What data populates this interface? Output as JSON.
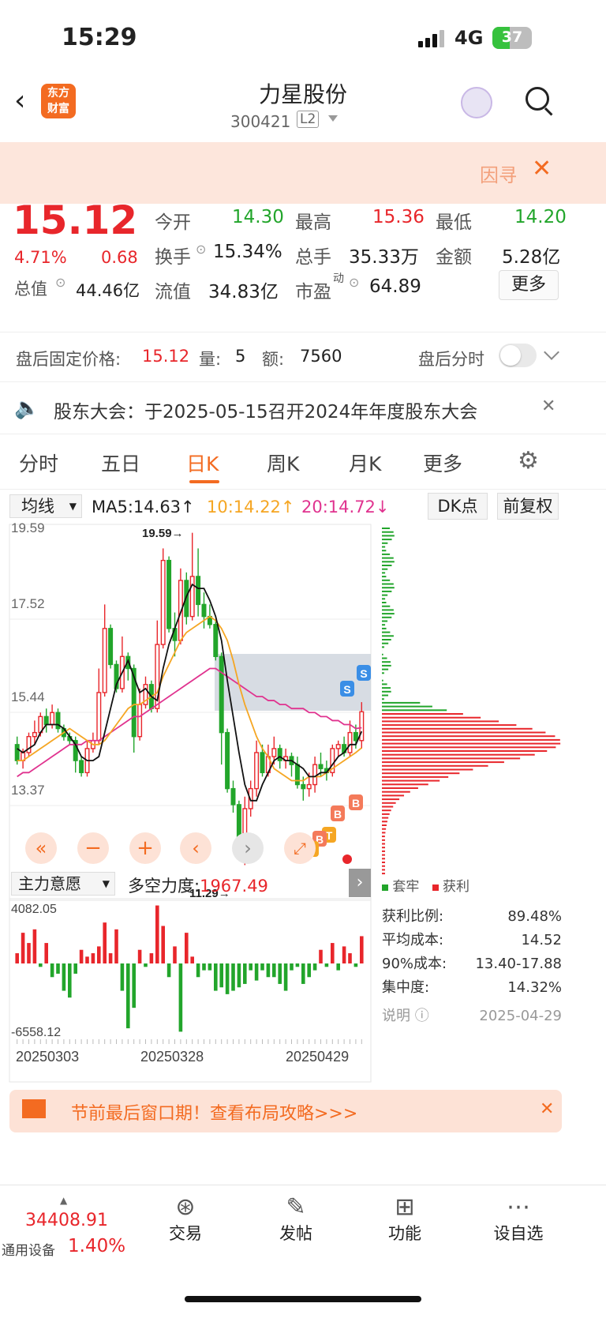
{
  "status": {
    "time": "15:29",
    "network": "4G",
    "battery": "37"
  },
  "header": {
    "brand": "东方\n财富",
    "title": "力星股份",
    "code": "300421",
    "level": "L2"
  },
  "notice": {
    "text": "因寻"
  },
  "quote": {
    "price": "15.12",
    "change_pct": "4.71%",
    "change": "0.68",
    "open_label": "今开",
    "open": "14.30",
    "high_label": "最高",
    "high": "15.36",
    "low_label": "最低",
    "low": "14.20",
    "turnover_label": "换手",
    "turnover": "15.34%",
    "volume_label": "总手",
    "volume": "35.33万",
    "amount_label": "金额",
    "amount": "5.28亿",
    "mktcap_label": "总值",
    "mktcap": "44.46亿",
    "float_label": "流值",
    "float": "34.83亿",
    "pe_label": "市盈",
    "pe_sup": "动",
    "pe": "64.89",
    "more": "更多"
  },
  "afterhours": {
    "label": "盘后固定价格:",
    "price": "15.12",
    "vol_label": "量:",
    "vol": "5",
    "amt_label": "额:",
    "amt": "7560",
    "tl_label": "盘后分时"
  },
  "announce": {
    "text": "股东大会：于2025-05-15召开2024年年度股东大会"
  },
  "tabs": {
    "t1": "分时",
    "t2": "五日",
    "t3": "日K",
    "t4": "周K",
    "t5": "月K",
    "t6": "更多"
  },
  "ma": {
    "selector": "均线",
    "ma5": "MA5:14.63↑",
    "ma10": "10:14.22↑",
    "ma20": "20:14.72↓",
    "dk": "DK点",
    "fq": "前复权"
  },
  "chart_data": {
    "type": "candlestick",
    "y_ticks": [
      "19.59",
      "17.52",
      "15.44",
      "13.37",
      "11.29"
    ],
    "max_label": "19.59→",
    "min_label": "11.29→",
    "candles": [
      [
        14.3,
        13.9,
        14.5,
        13.8
      ],
      [
        13.9,
        14.1,
        14.2,
        13.7
      ],
      [
        14.1,
        14.5,
        14.6,
        14
      ],
      [
        14.5,
        14.6,
        14.9,
        14.3
      ],
      [
        14.6,
        15,
        15.1,
        14.5
      ],
      [
        15,
        14.8,
        15.2,
        14.6
      ],
      [
        14.8,
        15.1,
        15.3,
        14.7
      ],
      [
        15.1,
        14.7,
        15.2,
        14.6
      ],
      [
        14.7,
        14.5,
        14.8,
        14.4
      ],
      [
        14.5,
        14.4,
        14.6,
        14.3
      ],
      [
        14.4,
        13.9,
        14.5,
        13.6
      ],
      [
        13.9,
        13.6,
        14,
        13.5
      ],
      [
        13.6,
        14.2,
        14.4,
        13.5
      ],
      [
        14.2,
        14.4,
        14.6,
        14.1
      ],
      [
        14.4,
        15.6,
        16.2,
        14.3
      ],
      [
        15.6,
        17.2,
        17.8,
        15.5
      ],
      [
        17.2,
        16.3,
        17.3,
        16.2
      ],
      [
        16.3,
        15.7,
        16.4,
        15.6
      ],
      [
        15.7,
        16.5,
        17,
        15.6
      ],
      [
        16.5,
        16.2,
        16.6,
        15.9
      ],
      [
        16.2,
        14.5,
        16.3,
        14.1
      ],
      [
        14.5,
        15.3,
        15.7,
        14.4
      ],
      [
        15.3,
        15.8,
        16,
        15.2
      ],
      [
        15.8,
        15.2,
        15.9,
        15.1
      ],
      [
        15.2,
        16.8,
        17.4,
        15.1
      ],
      [
        16.8,
        18.9,
        19.2,
        16.7
      ],
      [
        18.9,
        17.2,
        19,
        17.1
      ],
      [
        17.2,
        16.9,
        17.6,
        16.5
      ],
      [
        16.9,
        18.4,
        18.7,
        16.8
      ],
      [
        18.4,
        17.5,
        18.6,
        17.3
      ],
      [
        17.5,
        18.5,
        19.59,
        17.4
      ],
      [
        18.5,
        17.8,
        19.2,
        17.5
      ],
      [
        17.8,
        17.5,
        18.1,
        17.2
      ],
      [
        17.5,
        17.3,
        17.8,
        17.2
      ],
      [
        17.3,
        16.5,
        17.4,
        16.4
      ],
      [
        16.5,
        14.6,
        16.6,
        13.8
      ],
      [
        14.6,
        13.2,
        14.7,
        13.1
      ],
      [
        13.2,
        12.8,
        13.4,
        12.6
      ],
      [
        12.8,
        11.9,
        12.9,
        11.5
      ],
      [
        11.9,
        12.7,
        13,
        11.29
      ],
      [
        12.7,
        13.2,
        13.4,
        12.5
      ],
      [
        13.2,
        14.1,
        14.4,
        13
      ],
      [
        14.1,
        13.6,
        14.3,
        13.5
      ],
      [
        13.6,
        14,
        14.3,
        13.5
      ],
      [
        14,
        14.2,
        14.5,
        13.8
      ],
      [
        14.2,
        13.9,
        14.3,
        13.7
      ],
      [
        13.9,
        14,
        14.2,
        13.7
      ],
      [
        14,
        13.8,
        14.1,
        13.5
      ],
      [
        13.8,
        13.3,
        14,
        13.2
      ],
      [
        13.3,
        13.2,
        13.5,
        12.9
      ],
      [
        13.2,
        13.3,
        13.6,
        13
      ],
      [
        13.3,
        13.8,
        14,
        13.1
      ],
      [
        13.8,
        13.7,
        14.1,
        13.5
      ],
      [
        13.7,
        13.6,
        13.9,
        13.4
      ],
      [
        13.6,
        14.2,
        14.3,
        13.5
      ],
      [
        14.2,
        14.3,
        14.4,
        14
      ],
      [
        14.3,
        14.1,
        14.5,
        14
      ],
      [
        14.1,
        14.6,
        14.9,
        14
      ],
      [
        14.6,
        14.4,
        14.8,
        14.2
      ],
      [
        14.4,
        15.12,
        15.36,
        14.2
      ]
    ],
    "ma5": [
      14.2,
      14.1,
      14.2,
      14.3,
      14.6,
      14.8,
      14.8,
      14.8,
      14.7,
      14.5,
      14.3,
      14,
      13.9,
      13.9,
      14,
      14.6,
      15.2,
      15.8,
      16.1,
      16.4,
      16,
      15.6,
      15.7,
      15.5,
      15.4,
      16.2,
      16.8,
      17.2,
      17.6,
      18,
      18.3,
      18.2,
      18.2,
      17.9,
      17.5,
      16.9,
      15.9,
      15,
      14.1,
      13.3,
      12.9,
      12.9,
      13.3,
      13.6,
      13.9,
      14,
      13.9,
      13.9,
      13.8,
      13.7,
      13.5,
      13.5,
      13.6,
      13.6,
      13.8,
      14,
      14.1,
      14.3,
      14.3,
      14.63
    ],
    "ma10": [
      13.9,
      13.9,
      14,
      14.1,
      14.2,
      14.3,
      14.4,
      14.5,
      14.6,
      14.7,
      14.6,
      14.5,
      14.4,
      14.3,
      14.3,
      14.4,
      14.6,
      14.8,
      15,
      15.2,
      15.3,
      15.3,
      15.4,
      15.5,
      15.6,
      16,
      16.3,
      16.6,
      16.9,
      17.1,
      17.2,
      17.3,
      17.4,
      17.5,
      17.4,
      17.2,
      16.9,
      16.4,
      15.8,
      15.3,
      14.9,
      14.5,
      14.2,
      14,
      13.7,
      13.6,
      13.5,
      13.4,
      13.4,
      13.4,
      13.5,
      13.5,
      13.5,
      13.6,
      13.7,
      13.8,
      13.9,
      14,
      14.1,
      14.22
    ],
    "ma20": [
      13.5,
      13.6,
      13.6,
      13.7,
      13.8,
      13.9,
      14,
      14.1,
      14.2,
      14.3,
      14.3,
      14.3,
      14.4,
      14.4,
      14.4,
      14.5,
      14.6,
      14.7,
      14.8,
      14.9,
      15,
      15,
      15.1,
      15.2,
      15.3,
      15.4,
      15.5,
      15.6,
      15.7,
      15.8,
      15.9,
      16,
      16.1,
      16.2,
      16.2,
      16.1,
      16,
      15.9,
      15.8,
      15.7,
      15.6,
      15.5,
      15.5,
      15.4,
      15.4,
      15.3,
      15.3,
      15.2,
      15.2,
      15.2,
      15.1,
      15.1,
      15,
      15,
      14.9,
      14.9,
      14.8,
      14.8,
      14.7,
      14.72
    ],
    "flow": [
      15,
      45,
      30,
      50,
      -5,
      30,
      -20,
      -15,
      -40,
      -50,
      -15,
      20,
      10,
      15,
      25,
      60,
      15,
      50,
      -40,
      -95,
      -65,
      20,
      -5,
      15,
      85,
      55,
      -20,
      25,
      -100,
      45,
      10,
      -20,
      -10,
      -10,
      -40,
      -35,
      -45,
      -40,
      -35,
      -30,
      -10,
      -25,
      -10,
      -20,
      -20,
      -30,
      -40,
      -10,
      -5,
      -30,
      -20,
      -10,
      20,
      -5,
      30,
      -10,
      25,
      15,
      -5,
      40
    ],
    "flow_ticks": [
      "4082.05",
      "-6558.12"
    ],
    "dates": [
      "20250303",
      "20250328",
      "20250429"
    ],
    "chips_label": {
      "trap": "套牢",
      "profit": "获利"
    }
  },
  "panel": {
    "indicator": "主力意愿",
    "strength_label": "多空力度:",
    "strength": "1967.49"
  },
  "chips": {
    "r1l": "获利比例:",
    "r1v": "89.48%",
    "r2l": "平均成本:",
    "r2v": "14.52",
    "r3l": "90%成本:",
    "r3v": "13.40-17.88",
    "r4l": "集中度:",
    "r4v": "14.32%",
    "note": "说明",
    "date": "2025-04-29"
  },
  "promo": {
    "text": "节前最后窗口期！查看布局攻略>>>"
  },
  "bottom": {
    "index": "34408.91",
    "device": "通用设备",
    "pct": "1.40%",
    "b1": "交易",
    "b2": "发帖",
    "b3": "功能",
    "b4": "设自选"
  },
  "colors": {
    "up": "#e8262b",
    "down": "#22a52b",
    "ma5": "#111111",
    "ma10": "#f5a623",
    "ma20": "#e0338f"
  }
}
